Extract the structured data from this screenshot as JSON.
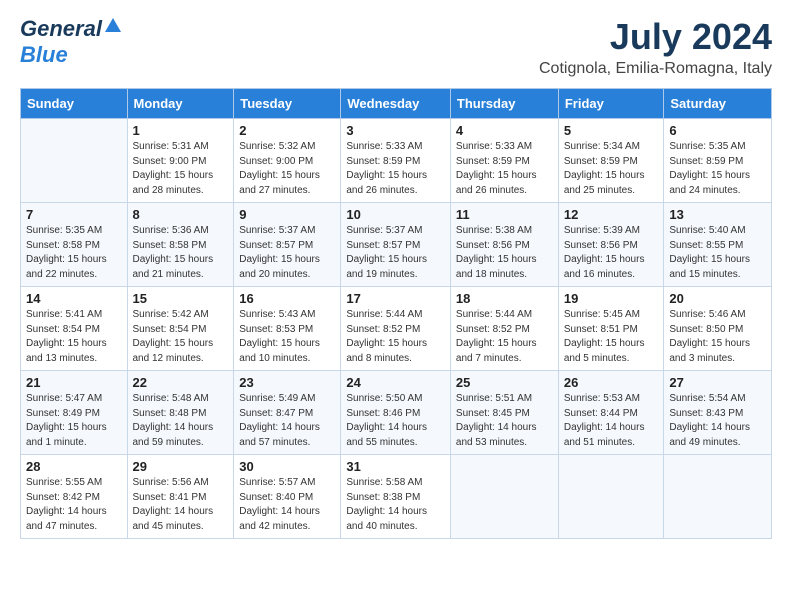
{
  "logo": {
    "general": "General",
    "blue": "Blue"
  },
  "title": "July 2024",
  "location": "Cotignola, Emilia-Romagna, Italy",
  "days_header": [
    "Sunday",
    "Monday",
    "Tuesday",
    "Wednesday",
    "Thursday",
    "Friday",
    "Saturday"
  ],
  "weeks": [
    [
      {
        "day": "",
        "info": ""
      },
      {
        "day": "1",
        "info": "Sunrise: 5:31 AM\nSunset: 9:00 PM\nDaylight: 15 hours\nand 28 minutes."
      },
      {
        "day": "2",
        "info": "Sunrise: 5:32 AM\nSunset: 9:00 PM\nDaylight: 15 hours\nand 27 minutes."
      },
      {
        "day": "3",
        "info": "Sunrise: 5:33 AM\nSunset: 8:59 PM\nDaylight: 15 hours\nand 26 minutes."
      },
      {
        "day": "4",
        "info": "Sunrise: 5:33 AM\nSunset: 8:59 PM\nDaylight: 15 hours\nand 26 minutes."
      },
      {
        "day": "5",
        "info": "Sunrise: 5:34 AM\nSunset: 8:59 PM\nDaylight: 15 hours\nand 25 minutes."
      },
      {
        "day": "6",
        "info": "Sunrise: 5:35 AM\nSunset: 8:59 PM\nDaylight: 15 hours\nand 24 minutes."
      }
    ],
    [
      {
        "day": "7",
        "info": "Sunrise: 5:35 AM\nSunset: 8:58 PM\nDaylight: 15 hours\nand 22 minutes."
      },
      {
        "day": "8",
        "info": "Sunrise: 5:36 AM\nSunset: 8:58 PM\nDaylight: 15 hours\nand 21 minutes."
      },
      {
        "day": "9",
        "info": "Sunrise: 5:37 AM\nSunset: 8:57 PM\nDaylight: 15 hours\nand 20 minutes."
      },
      {
        "day": "10",
        "info": "Sunrise: 5:37 AM\nSunset: 8:57 PM\nDaylight: 15 hours\nand 19 minutes."
      },
      {
        "day": "11",
        "info": "Sunrise: 5:38 AM\nSunset: 8:56 PM\nDaylight: 15 hours\nand 18 minutes."
      },
      {
        "day": "12",
        "info": "Sunrise: 5:39 AM\nSunset: 8:56 PM\nDaylight: 15 hours\nand 16 minutes."
      },
      {
        "day": "13",
        "info": "Sunrise: 5:40 AM\nSunset: 8:55 PM\nDaylight: 15 hours\nand 15 minutes."
      }
    ],
    [
      {
        "day": "14",
        "info": "Sunrise: 5:41 AM\nSunset: 8:54 PM\nDaylight: 15 hours\nand 13 minutes."
      },
      {
        "day": "15",
        "info": "Sunrise: 5:42 AM\nSunset: 8:54 PM\nDaylight: 15 hours\nand 12 minutes."
      },
      {
        "day": "16",
        "info": "Sunrise: 5:43 AM\nSunset: 8:53 PM\nDaylight: 15 hours\nand 10 minutes."
      },
      {
        "day": "17",
        "info": "Sunrise: 5:44 AM\nSunset: 8:52 PM\nDaylight: 15 hours\nand 8 minutes."
      },
      {
        "day": "18",
        "info": "Sunrise: 5:44 AM\nSunset: 8:52 PM\nDaylight: 15 hours\nand 7 minutes."
      },
      {
        "day": "19",
        "info": "Sunrise: 5:45 AM\nSunset: 8:51 PM\nDaylight: 15 hours\nand 5 minutes."
      },
      {
        "day": "20",
        "info": "Sunrise: 5:46 AM\nSunset: 8:50 PM\nDaylight: 15 hours\nand 3 minutes."
      }
    ],
    [
      {
        "day": "21",
        "info": "Sunrise: 5:47 AM\nSunset: 8:49 PM\nDaylight: 15 hours\nand 1 minute."
      },
      {
        "day": "22",
        "info": "Sunrise: 5:48 AM\nSunset: 8:48 PM\nDaylight: 14 hours\nand 59 minutes."
      },
      {
        "day": "23",
        "info": "Sunrise: 5:49 AM\nSunset: 8:47 PM\nDaylight: 14 hours\nand 57 minutes."
      },
      {
        "day": "24",
        "info": "Sunrise: 5:50 AM\nSunset: 8:46 PM\nDaylight: 14 hours\nand 55 minutes."
      },
      {
        "day": "25",
        "info": "Sunrise: 5:51 AM\nSunset: 8:45 PM\nDaylight: 14 hours\nand 53 minutes."
      },
      {
        "day": "26",
        "info": "Sunrise: 5:53 AM\nSunset: 8:44 PM\nDaylight: 14 hours\nand 51 minutes."
      },
      {
        "day": "27",
        "info": "Sunrise: 5:54 AM\nSunset: 8:43 PM\nDaylight: 14 hours\nand 49 minutes."
      }
    ],
    [
      {
        "day": "28",
        "info": "Sunrise: 5:55 AM\nSunset: 8:42 PM\nDaylight: 14 hours\nand 47 minutes."
      },
      {
        "day": "29",
        "info": "Sunrise: 5:56 AM\nSunset: 8:41 PM\nDaylight: 14 hours\nand 45 minutes."
      },
      {
        "day": "30",
        "info": "Sunrise: 5:57 AM\nSunset: 8:40 PM\nDaylight: 14 hours\nand 42 minutes."
      },
      {
        "day": "31",
        "info": "Sunrise: 5:58 AM\nSunset: 8:38 PM\nDaylight: 14 hours\nand 40 minutes."
      },
      {
        "day": "",
        "info": ""
      },
      {
        "day": "",
        "info": ""
      },
      {
        "day": "",
        "info": ""
      }
    ]
  ]
}
